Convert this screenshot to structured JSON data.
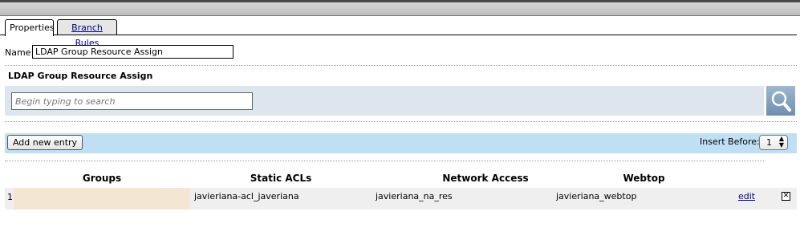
{
  "tabs": [
    {
      "label": "Properties",
      "active": true
    },
    {
      "label": "Branch Rules",
      "active": false
    }
  ],
  "name_field": {
    "label": "Name:",
    "value": "LDAP Group Resource Assign"
  },
  "section": {
    "title": "LDAP Group Resource Assign"
  },
  "search": {
    "placeholder": "Begin typing to search",
    "icon": "magnifier-icon"
  },
  "actions": {
    "add_label": "Add new entry",
    "insert_before_label": "Insert Before:",
    "insert_before_value": "1"
  },
  "table": {
    "headers": [
      "Groups",
      "Static ACLs",
      "Network Access",
      "Webtop"
    ],
    "rows": [
      {
        "index": "1",
        "groups": "",
        "static_acls": "javieriana-acl_javeriana",
        "network_access": "javieriana_na_res",
        "webtop": "javieriana_webtop",
        "edit_label": "edit",
        "delete_glyph": "✕"
      }
    ]
  },
  "colors": {
    "search_band": "#dde5ee",
    "action_band": "#bfe0f4",
    "groups_cell": "#f3e7d3",
    "link": "#000080"
  }
}
